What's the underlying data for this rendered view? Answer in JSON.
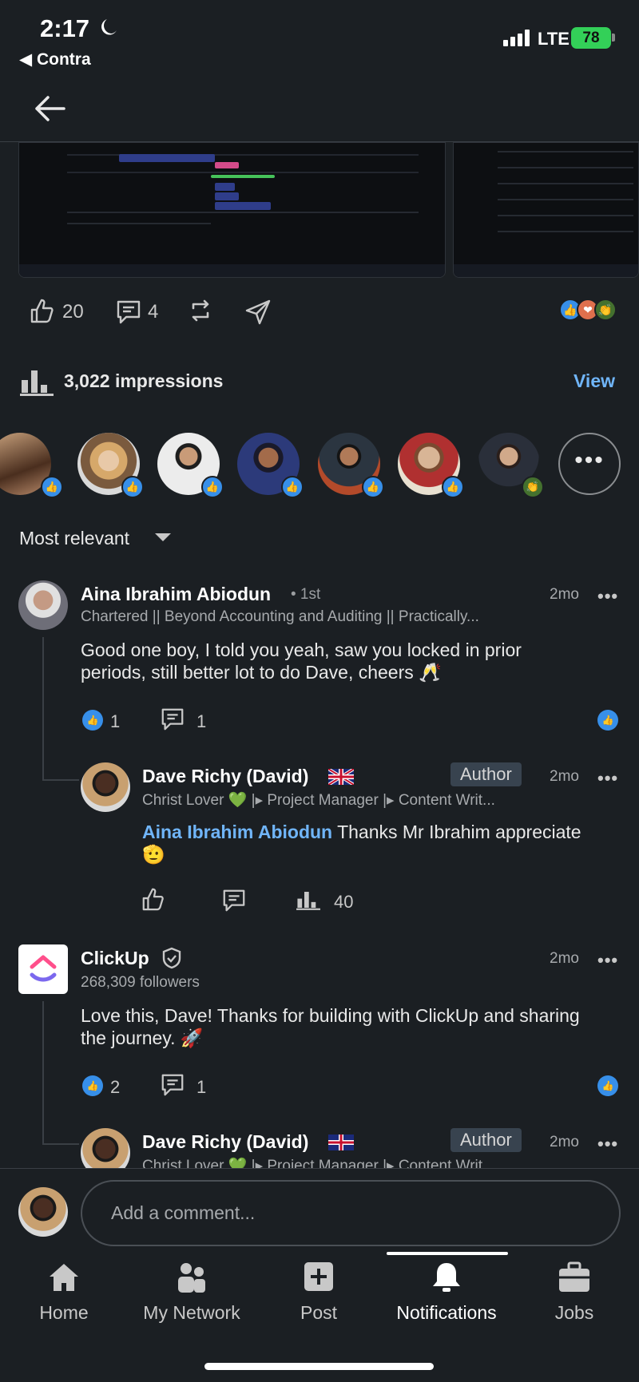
{
  "status_bar": {
    "time": "2:17",
    "back_app": "◀ Contra",
    "network": "LTE",
    "battery": "78"
  },
  "post_actions": {
    "likes": "20",
    "comments": "4"
  },
  "impressions": {
    "label": "3,022 impressions",
    "view_label": "View"
  },
  "sort": {
    "label": "Most relevant"
  },
  "comments": [
    {
      "name": "Aina Ibrahim Abiodun",
      "degree": "• 1st",
      "headline": "Chartered || Beyond Accounting and Auditing || Practically...",
      "time": "2mo",
      "text": "Good one boy, I told you yeah, saw you locked in prior periods, still better lot to do Dave, cheers 🥂",
      "likes": "1",
      "replies": "1",
      "reply": {
        "name": "Dave Richy (David)",
        "badge": "Author",
        "time": "2mo",
        "headline": "Christ Lover 💚 |▸ Project Manager |▸ Content Writ...",
        "mention": "Aina Ibrahim Abiodun",
        "text": " Thanks Mr Ibrahim appreciate 🫡",
        "impressions": "40"
      }
    },
    {
      "name": "ClickUp",
      "followers": "268,309 followers",
      "time": "2mo",
      "text": "Love this, Dave! Thanks for building with ClickUp and sharing the journey. 🚀",
      "likes": "2",
      "replies": "1",
      "reply": {
        "name": "Dave Richy (David)",
        "badge": "Author",
        "time": "2mo",
        "headline": "Christ Lover 💚 |▸ Project Manager |▸ Content Writ..."
      }
    }
  ],
  "comment_input": {
    "placeholder": "Add a comment..."
  },
  "tabs": [
    {
      "label": "Home",
      "icon": "home-icon"
    },
    {
      "label": "My Network",
      "icon": "people-icon"
    },
    {
      "label": "Post",
      "icon": "plus-square-icon"
    },
    {
      "label": "Notifications",
      "icon": "bell-icon"
    },
    {
      "label": "Jobs",
      "icon": "briefcase-icon"
    }
  ],
  "colors": {
    "background": "#1b1f23",
    "link": "#70b5f9",
    "like_blue": "#378fe9"
  }
}
